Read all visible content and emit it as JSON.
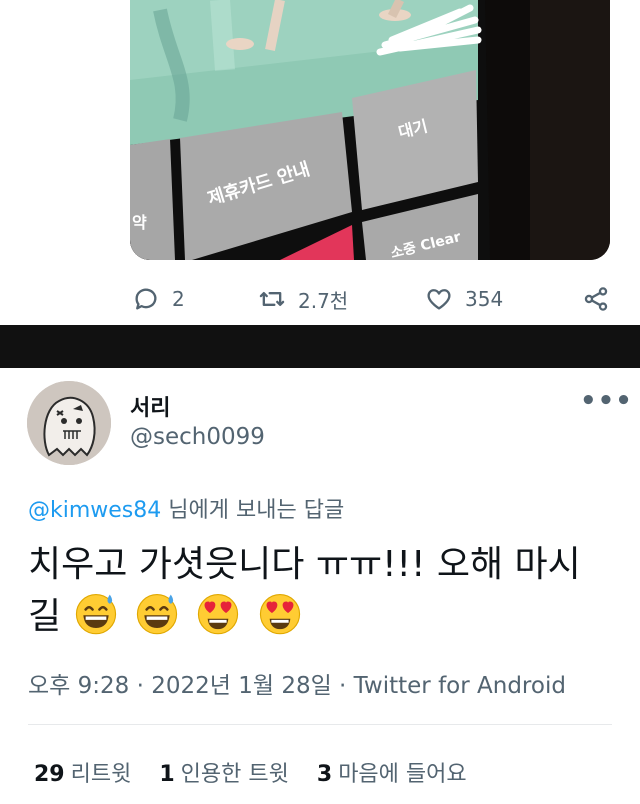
{
  "top_tweet": {
    "image": {
      "screen_texts": {
        "card_notice": "제휴카드 안내",
        "wait": "대기",
        "clear": "소중 Clear",
        "partial_left": "약"
      }
    },
    "actions": {
      "replies": "2",
      "retweets": "2.7천",
      "likes": "354"
    }
  },
  "reply_tweet": {
    "display_name": "서리",
    "handle": "@sech0099",
    "replying_to": {
      "mention": "@kimwes84",
      "suffix": " 님에게 보내는 답글"
    },
    "text_line1": "치우고 가셧읏니다 ㅠㅠ!!! 오해 마시",
    "text_line2": "길",
    "emojis": [
      "sweat-smile",
      "sweat-smile",
      "heart-eyes",
      "heart-eyes"
    ],
    "meta": "오후 9:28 · 2022년 1월 28일 · Twitter for Android",
    "stats": {
      "retweets_count": "29",
      "retweets_label": "리트윗",
      "quotes_count": "1",
      "quotes_label": "인용한 트윗",
      "likes_count": "3",
      "likes_label": "마음에 들어요"
    },
    "more_icon": "ellipsis-icon"
  },
  "colors": {
    "text_primary": "#0f1419",
    "text_secondary": "#536471",
    "mention": "#1d9bf0",
    "band": "#111111"
  }
}
